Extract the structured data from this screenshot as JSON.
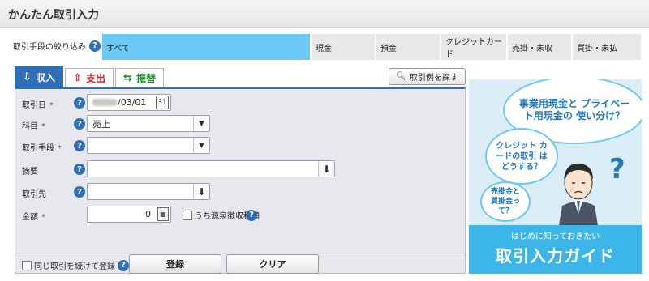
{
  "header": {
    "title": "かんたん取引入力"
  },
  "filter": {
    "label": "取引手段の絞り込み",
    "segments": [
      "すべて",
      "現金",
      "預金",
      "クレジットカード",
      "売掛・未収",
      "買掛・未払"
    ],
    "active_index": 0
  },
  "tabs": [
    {
      "label": "収入",
      "icon": "income-icon"
    },
    {
      "label": "支出",
      "icon": "expense-icon"
    },
    {
      "label": "振替",
      "icon": "transfer-icon"
    }
  ],
  "search_examples": {
    "label": "取引例を探す"
  },
  "form": {
    "date": {
      "label": "取引日",
      "value": "/03/01"
    },
    "account": {
      "label": "科目",
      "value": "売上"
    },
    "method": {
      "label": "取引手段",
      "value": ""
    },
    "memo": {
      "label": "摘要",
      "value": ""
    },
    "partner": {
      "label": "取引先",
      "value": ""
    },
    "amount": {
      "label": "金額",
      "value": "0"
    },
    "withholding_label": "うち源泉徴収税額",
    "continue_label": "同じ取引を続けて登録",
    "register_button": "登録",
    "clear_button": "クリア",
    "required_mark": "*"
  },
  "ad": {
    "bubble1": "事業用現金と プライベート用現金の 使い分け？",
    "bubble2": "クレジット カードの取引 はどうする？",
    "bubble3": "売掛金と 買掛金って？",
    "question_mark": "?",
    "sub": "はじめに知っておきたい",
    "main": "取引入力ガイド"
  }
}
